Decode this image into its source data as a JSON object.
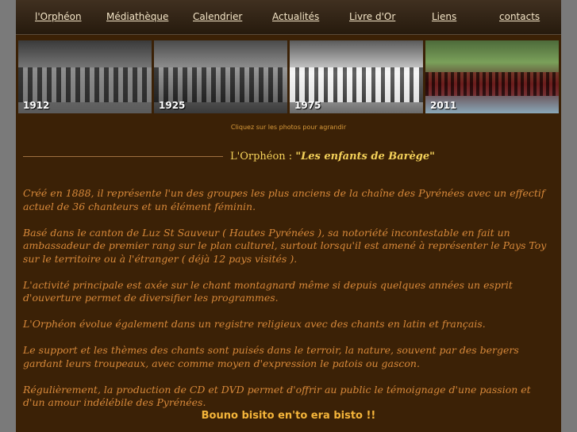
{
  "nav": {
    "items": [
      {
        "label": "l'Orphéon"
      },
      {
        "label": "Médiathèque"
      },
      {
        "label": "Calendrier"
      },
      {
        "label": "Actualités"
      },
      {
        "label": "Livre d'Or"
      },
      {
        "label": "Liens"
      },
      {
        "label": "contacts"
      }
    ]
  },
  "photos": [
    {
      "year": "1912"
    },
    {
      "year": "1925"
    },
    {
      "year": "1975"
    },
    {
      "year": "2011"
    }
  ],
  "caption": "Cliquez sur les photos pour agrandir",
  "heading": {
    "prefix": "L'Orphéon : ",
    "quote": "\"Les enfants de Barège\""
  },
  "paragraphs": [
    "Créé en 1888, il représente l'un des groupes les plus anciens de la chaîne des Pyrénées avec un effectif actuel de 36 chanteurs  et un élément féminin.",
    "Basé dans le canton de Luz St Sauveur ( Hautes Pyrénées ), sa notoriété incontestable en fait un ambassadeur de premier rang sur le plan culturel, surtout lorsqu'il est amené à représenter le Pays Toy sur le territoire ou à l'étranger ( déjà 12 pays visités ).",
    "L'activité principale est axée sur le chant montagnard même si depuis quelques années un esprit d'ouverture permet de diversifier les programmes.",
    "L'Orphéon évolue également dans un registre religieux avec des chants en latin et français.",
    "Le support et les thèmes des chants sont puisés dans le terroir, la nature, souvent par des bergers gardant leurs troupeaux, avec comme moyen d'expression le patois ou gascon.",
    "Régulièrement, la production de CD et DVD permet d'offrir au public le témoignage d'une passion et d'un amour indélébile des Pyrénées."
  ],
  "closing": "Bouno bisito en'to era bisto !!"
}
